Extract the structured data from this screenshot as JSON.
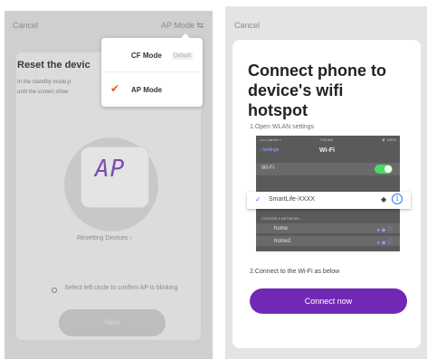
{
  "left_screen": {
    "cancel_label": "Cancel",
    "mode_label": "AP Mode ⇆",
    "reset_title": "Reset the devic",
    "reset_desc_line1": "In the standby mode,p",
    "reset_desc_line2": "until the screen show",
    "device_display": "AP",
    "resetting_label": "Resetting Devices ›",
    "confirm_text": "Select left circle to confirm AP is blinking",
    "next_label": "Next",
    "dropdown": {
      "items": [
        {
          "label": "CF Mode",
          "badge": "Default",
          "selected": false
        },
        {
          "label": "AP Mode",
          "badge": "",
          "selected": true
        }
      ],
      "check_glyph": "✔",
      "accent_color": "#e8551e"
    }
  },
  "right_screen": {
    "cancel_label": "Cancel",
    "title": "Connect phone to device's wifi hotspot",
    "step1": "1.Open WLAN settings",
    "ios": {
      "carrier": "••••• Carrier ▿",
      "time": "7:53 AM",
      "battery": "⚡ 100%",
      "back_label": "‹ Settings",
      "nav_title": "Wi-Fi",
      "wifi_label": "Wi-Fi",
      "choose_label": "CHOOSE A NETWORK...",
      "networks": [
        {
          "name": "home",
          "icons": "● ◆ ⓘ"
        },
        {
          "name": "home2",
          "icons": "● ◆ ⓘ"
        }
      ]
    },
    "highlight": {
      "check": "✓",
      "name": "SmartLife-XXXX",
      "wifi_icon": "◆",
      "info_icon": "i"
    },
    "step2": "2.Connect to the Wi-Fi as below",
    "connect_label": "Connect now",
    "accent_color": "#7129b5"
  }
}
